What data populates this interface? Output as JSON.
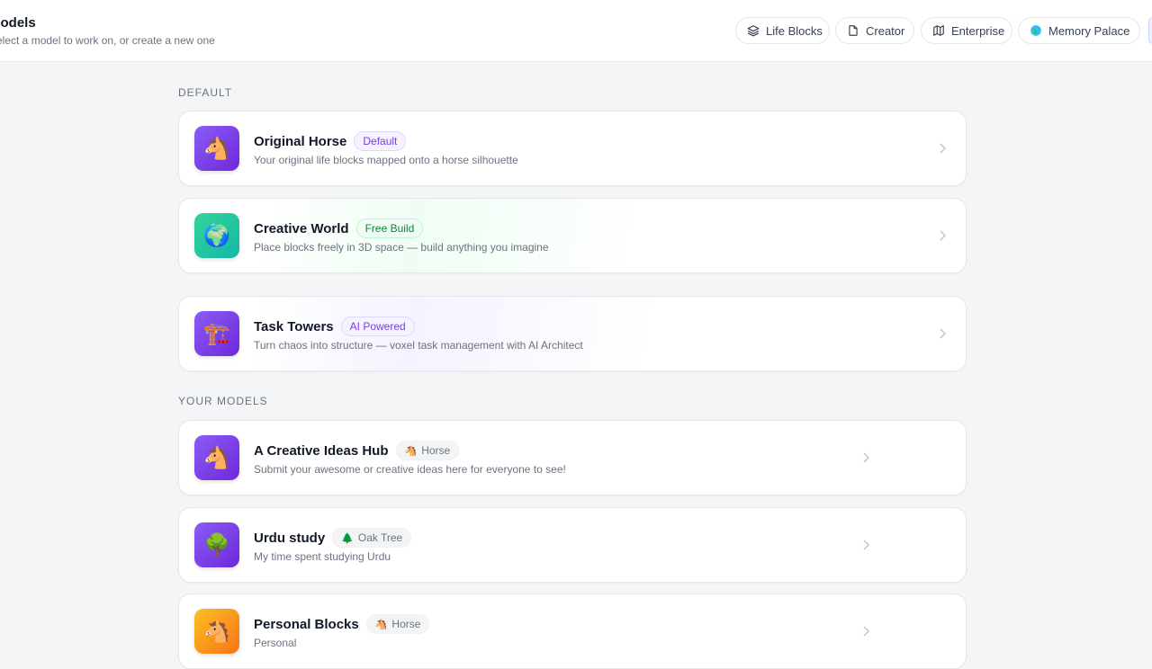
{
  "header": {
    "title": "Models",
    "subtitle": "Select a model to work on, or create a new one",
    "nav": [
      {
        "label": "Life Blocks",
        "icon": "layers-icon"
      },
      {
        "label": "Creator",
        "icon": "file-icon"
      },
      {
        "label": "Enterprise",
        "icon": "map-icon"
      },
      {
        "label": "Memory Palace",
        "icon": "globe-icon"
      }
    ]
  },
  "sections": {
    "default_label": "DEFAULT",
    "yours_label": "YOUR MODELS"
  },
  "default_models": [
    {
      "title": "Original Horse",
      "badge": "Default",
      "description": "Your original life blocks mapped onto a horse silhouette",
      "icon": "🐴"
    },
    {
      "title": "Creative World",
      "badge": "Free Build",
      "description": "Place blocks freely in 3D space — build anything you imagine",
      "icon": "🌍"
    },
    {
      "title": "Task Towers",
      "badge": "AI Powered",
      "description": "Turn chaos into structure — voxel task management with AI Architect",
      "icon": "🏗️"
    }
  ],
  "user_models": [
    {
      "title": "A Creative Ideas Hub",
      "badge": "Horse",
      "badge_icon": "🐴",
      "description": "Submit your awesome or creative ideas here for everyone to see!",
      "icon": "🐴"
    },
    {
      "title": "Urdu study",
      "badge": "Oak Tree",
      "badge_icon": "🌲",
      "description": "My time spent studying Urdu",
      "icon": "🌳"
    },
    {
      "title": "Personal Blocks",
      "badge": "Horse",
      "badge_icon": "🐴",
      "description": "Personal",
      "icon": "🐴"
    }
  ],
  "colors": {
    "accent": "#7c3aed",
    "green": "#15803d",
    "background": "#f4f5f7"
  }
}
